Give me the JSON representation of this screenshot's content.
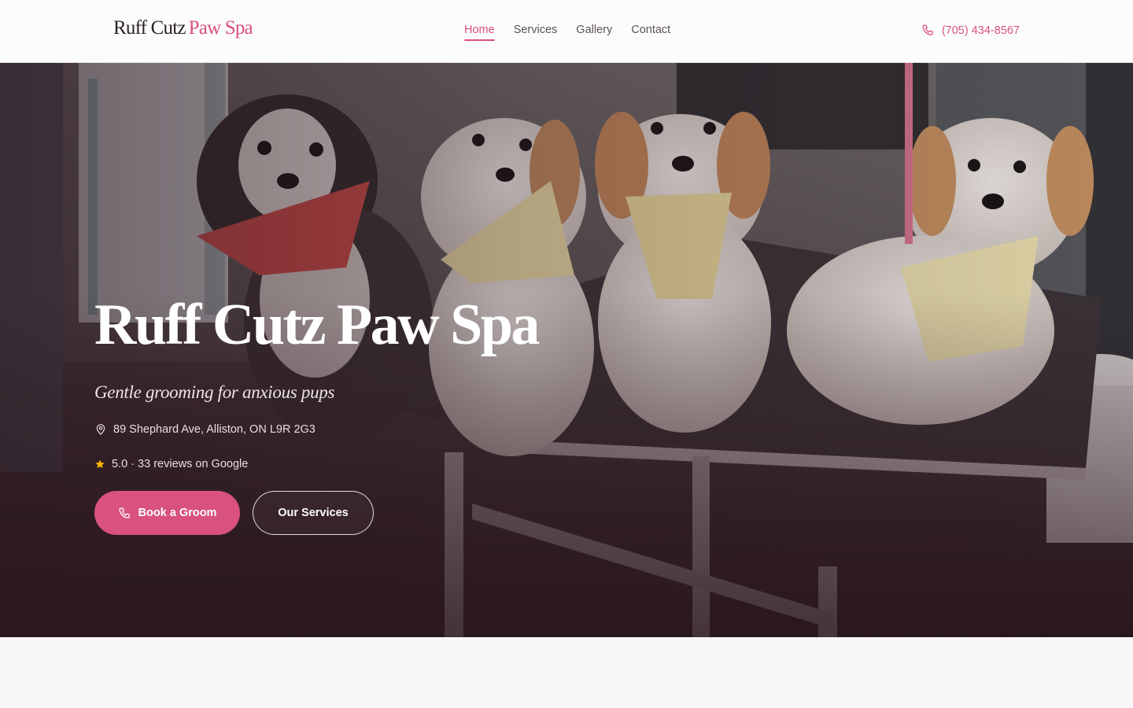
{
  "brand": {
    "name_main": "Ruff Cutz",
    "name_accent": "Paw Spa",
    "accent_color": "#d9517f"
  },
  "nav": {
    "items": [
      {
        "label": "Home",
        "active": true
      },
      {
        "label": "Services",
        "active": false
      },
      {
        "label": "Gallery",
        "active": false
      },
      {
        "label": "Contact",
        "active": false
      }
    ]
  },
  "header": {
    "phone": "(705) 434-8567",
    "phone_icon": "phone-icon"
  },
  "hero": {
    "title": "Ruff Cutz Paw Spa",
    "tagline": "Gentle grooming for anxious pups",
    "address": "89 Shephard Ave, Alliston, ON L9R 2G3",
    "address_icon": "map-pin-icon",
    "rating": "5.0 · 33 reviews on Google",
    "rating_icon": "star-icon",
    "rating_color": "#f5b800",
    "primary_cta": "Book a Groom",
    "secondary_cta": "Our Services"
  }
}
